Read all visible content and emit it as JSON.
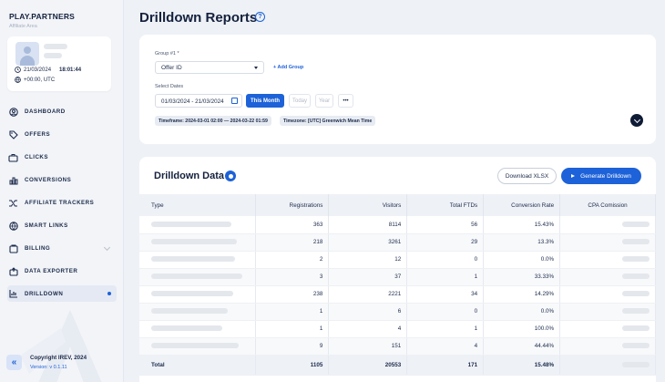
{
  "sidebar": {
    "brand": "PLAY.PARTNERS",
    "brand_sub": "Affiliate Area",
    "user": {
      "date": "21/03/2024",
      "time": "18:01:44",
      "timezone": "+00:00, UTC"
    },
    "items": [
      {
        "label": "DASHBOARD",
        "icon": "user-circle-icon"
      },
      {
        "label": "OFFERS",
        "icon": "tag-icon"
      },
      {
        "label": "CLICKS",
        "icon": "briefcase-icon"
      },
      {
        "label": "CONVERSIONS",
        "icon": "bar-chart-icon"
      },
      {
        "label": "AFFILIATE TRACKERS",
        "icon": "shuffle-icon"
      },
      {
        "label": "SMART LINKS",
        "icon": "globe-icon"
      },
      {
        "label": "BILLING",
        "icon": "wallet-icon"
      },
      {
        "label": "DATA EXPORTER",
        "icon": "export-icon"
      },
      {
        "label": "DRILLDOWN",
        "icon": "chart-icon"
      }
    ],
    "footer": {
      "copyright": "Copyright IREV, 2024",
      "version": "Version: v 0.1.11"
    }
  },
  "header": {
    "title": "Drilldown Reports"
  },
  "filters": {
    "group_label": "Group #1 *",
    "group_value": "Offer ID",
    "add_group": "+ Add Group",
    "dates_label": "Select Dates",
    "date_range": "01/03/2024 - 21/03/2024",
    "presets": [
      "This Month",
      "Today",
      "Year",
      "•••"
    ],
    "timeframe_tag": "Timeframe: 2024-03-01 02:00 — 2024-03-22 01:59",
    "timezone_tag": "Timezone: [UTC] Greenwich Mean Time"
  },
  "data": {
    "title": "Drilldown Data",
    "export_label": "Download XLSX",
    "generate_label": "Generate Drilldown",
    "columns": [
      "Type",
      "Registrations",
      "Visitors",
      "Total FTDs",
      "Conversion Rate",
      "CPA Comission"
    ],
    "rows": [
      {
        "registrations": "363",
        "visitors": "8114",
        "ftds": "56",
        "rate": "15.43%"
      },
      {
        "registrations": "218",
        "visitors": "3261",
        "ftds": "29",
        "rate": "13.3%"
      },
      {
        "registrations": "2",
        "visitors": "12",
        "ftds": "0",
        "rate": "0.0%"
      },
      {
        "registrations": "3",
        "visitors": "37",
        "ftds": "1",
        "rate": "33.33%"
      },
      {
        "registrations": "238",
        "visitors": "2221",
        "ftds": "34",
        "rate": "14.29%"
      },
      {
        "registrations": "1",
        "visitors": "6",
        "ftds": "0",
        "rate": "0.0%"
      },
      {
        "registrations": "1",
        "visitors": "4",
        "ftds": "1",
        "rate": "100.0%"
      },
      {
        "registrations": "9",
        "visitors": "151",
        "ftds": "4",
        "rate": "44.44%"
      }
    ],
    "total": {
      "label": "Total",
      "registrations": "1105",
      "visitors": "20553",
      "ftds": "171",
      "rate": "15.48%"
    }
  }
}
